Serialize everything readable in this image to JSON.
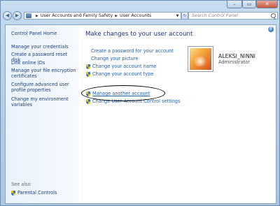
{
  "window": {
    "minimize_glyph": "–",
    "maximize_glyph": "▭",
    "close_glyph": "✕"
  },
  "navbar": {
    "back_glyph": "◀",
    "forward_glyph": "▶",
    "breadcrumb": [
      "User Accounts and Family Safety",
      "User Accounts"
    ],
    "separator_glyph": "▶",
    "dropdown_glyph": "▼",
    "refresh_glyph": "↻",
    "search_placeholder": "Search Control Panel"
  },
  "sidebar": {
    "home": "Control Panel Home",
    "links": [
      "Manage your credentials",
      "Create a password reset disk",
      "Link online IDs",
      "Manage your file encryption certificates",
      "Configure advanced user profile properties",
      "Change my environment variables"
    ],
    "see_also": "See also",
    "parental_controls": "Parental Controls"
  },
  "main": {
    "heading": "Make changes to your user account",
    "help_glyph": "?",
    "tasks": [
      {
        "label": "Create a password for your account",
        "icon": "none"
      },
      {
        "label": "Change your picture",
        "icon": "none"
      },
      {
        "label": "Change your account name",
        "icon": "uac-shield-icon"
      },
      {
        "label": "Change your account type",
        "icon": "uac-shield-icon"
      },
      {
        "label": "Manage another account",
        "icon": "uac-shield-icon"
      },
      {
        "label": "Change User Account Control settings",
        "icon": "uac-shield-icon"
      }
    ]
  },
  "user": {
    "name": "ALEKSI_NINNI",
    "role": "Administrator"
  },
  "colors": {
    "link": "#1f5fa6",
    "heading": "#1e3287",
    "sidebar_link": "#1f3d7a",
    "annotation": "#000000"
  }
}
